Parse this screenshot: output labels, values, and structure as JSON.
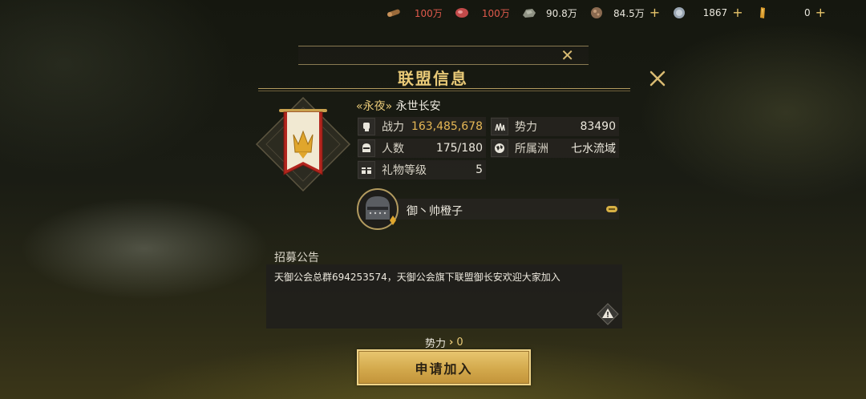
{
  "resources": [
    {
      "name": "wood",
      "icon": "wood-log-icon",
      "value": "100万",
      "color": "#e05a4c",
      "plus": false
    },
    {
      "name": "food",
      "icon": "meat-icon",
      "value": "100万",
      "color": "#e05a4c",
      "plus": false
    },
    {
      "name": "stone",
      "icon": "stone-icon",
      "value": "90.8万",
      "color": "#e9e6dc",
      "plus": false
    },
    {
      "name": "gold",
      "icon": "ore-icon",
      "value": "84.5万",
      "color": "#e9e6dc",
      "plus": true
    },
    {
      "name": "silver",
      "icon": "silver-coin-icon",
      "value": "1867",
      "color": "#e9e6dc",
      "plus": true
    },
    {
      "name": "premium",
      "icon": "gem-icon",
      "value": "0",
      "color": "#e9e6dc",
      "plus": true
    }
  ],
  "resource_plus_label": "+",
  "header": {
    "title": "联盟信息",
    "close_symbol": "✕"
  },
  "alliance": {
    "tag": "«永夜»",
    "name": "永世长安",
    "stats": [
      {
        "label": "战力",
        "value": "163,485,678",
        "icon": "fist-icon",
        "gold": true
      },
      {
        "label": "势力",
        "value": "83490",
        "icon": "army-icon",
        "gold": false
      },
      {
        "label": "人数",
        "value": "175/180",
        "icon": "helmet-icon",
        "gold": false
      },
      {
        "label": "所属洲",
        "value": "七水流域",
        "icon": "globe-icon",
        "gold": false
      },
      {
        "label": "礼物等级",
        "value": "5",
        "icon": "gift-chest-icon",
        "gold": false
      }
    ]
  },
  "leader": {
    "name": "御丶帅橙子"
  },
  "announcement": {
    "label": "招募公告",
    "text": "天御公会总群694253574，天御公会旗下联盟御长安欢迎大家加入"
  },
  "requirement": {
    "label": "势力",
    "arrow": "›",
    "value": "0"
  },
  "apply_button": {
    "label": "申请加入"
  }
}
